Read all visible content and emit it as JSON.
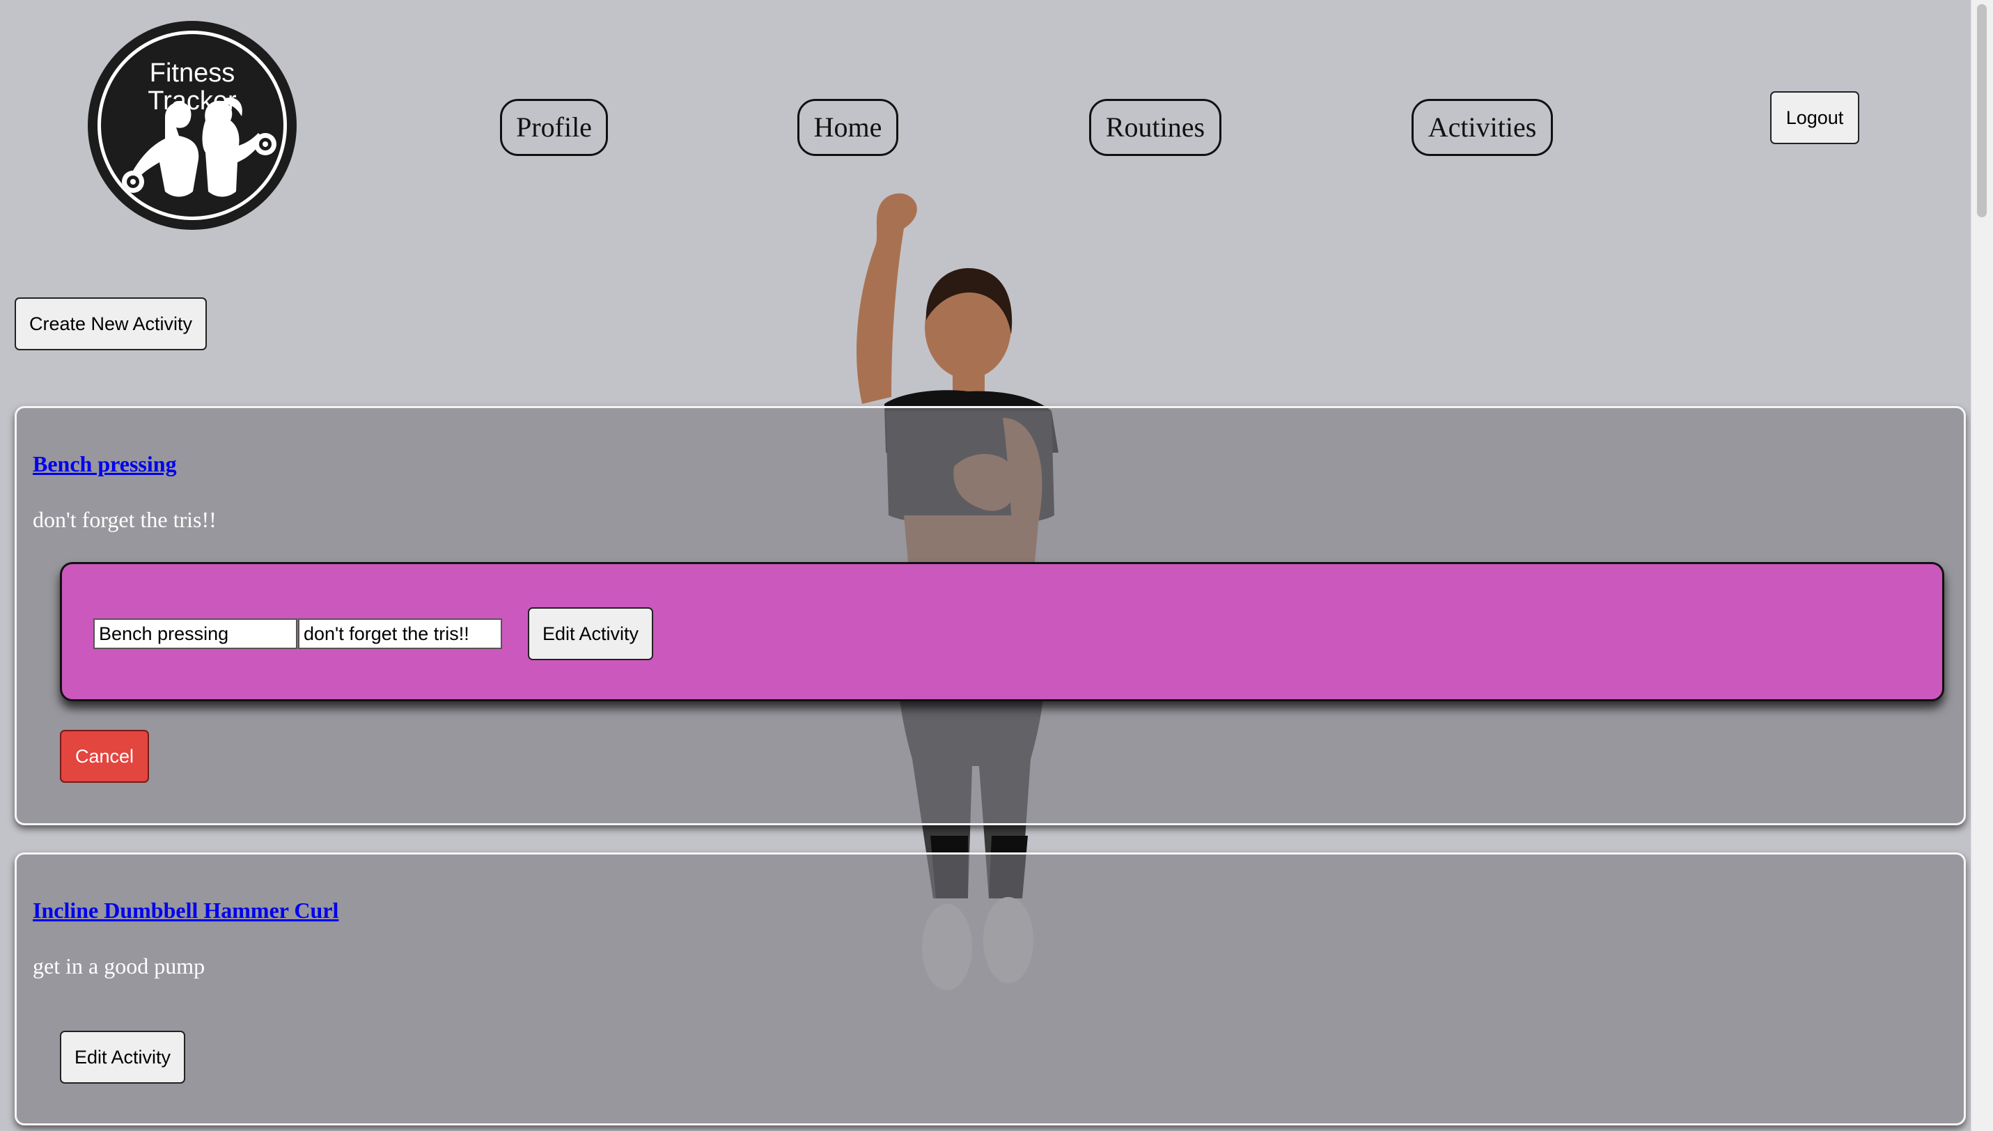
{
  "logo": {
    "text": "Fitness\nTracker",
    "icon": "fitness-couple-dumbbells-logo"
  },
  "nav": {
    "profile": "Profile",
    "home": "Home",
    "routines": "Routines",
    "activities": "Activities"
  },
  "header": {
    "logout_label": "Logout"
  },
  "toolbar": {
    "create_label": "Create New Activity"
  },
  "activities": [
    {
      "name": "Bench pressing",
      "description": "don't forget the tris!!",
      "editing": true,
      "form": {
        "name_value": "Bench pressing",
        "description_value": "don't forget the tris!!",
        "submit_label": "Edit Activity",
        "cancel_label": "Cancel"
      }
    },
    {
      "name": "Incline Dumbbell Hammer Curl",
      "description": "get in a good pump",
      "editing": false,
      "edit_label": "Edit Activity"
    }
  ],
  "colors": {
    "background": "#c2c3c8",
    "card": "#8e8f93",
    "form": "#cb58bd",
    "cancel": "#e3453f",
    "link": "#0000ee"
  }
}
